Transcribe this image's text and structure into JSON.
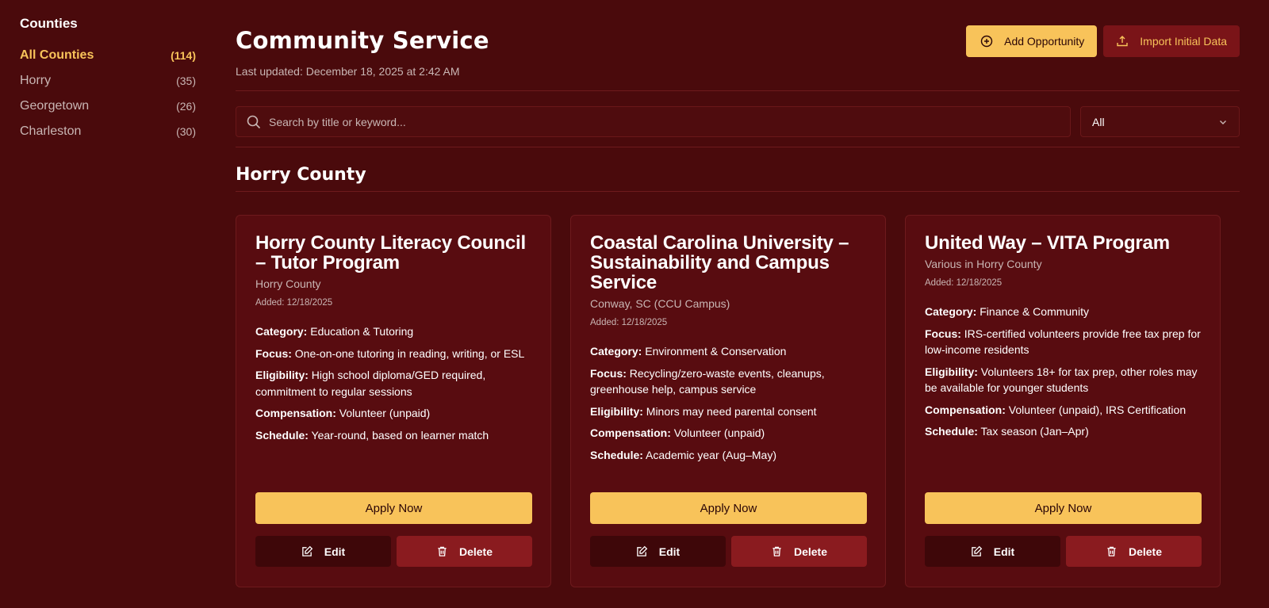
{
  "sidebar": {
    "heading": "Counties",
    "items": [
      {
        "label": "All Counties",
        "count": "(114)"
      },
      {
        "label": "Horry",
        "count": "(35)"
      },
      {
        "label": "Georgetown",
        "count": "(26)"
      },
      {
        "label": "Charleston",
        "count": "(30)"
      }
    ]
  },
  "header": {
    "title": "Community Service",
    "updated": "Last updated: December 18, 2025 at 2:42 AM",
    "add_label": "Add Opportunity",
    "import_label": "Import Initial Data"
  },
  "search": {
    "placeholder": "Search by title or keyword..."
  },
  "filter": {
    "selected": "All"
  },
  "section": {
    "title": "Horry County"
  },
  "labels": {
    "category": "Category:",
    "focus": "Focus:",
    "eligibility": "Eligibility:",
    "compensation": "Compensation:",
    "schedule": "Schedule:",
    "apply": "Apply Now",
    "edit": "Edit",
    "delete": "Delete"
  },
  "cards": [
    {
      "title": "Horry County Literacy Council – Tutor Program",
      "location": "Horry County",
      "added": "Added: 12/18/2025",
      "category": "Education & Tutoring",
      "focus": "One-on-one tutoring in reading, writing, or ESL",
      "eligibility": "High school diploma/GED required, commitment to regular sessions",
      "compensation": "Volunteer (unpaid)",
      "schedule": "Year-round, based on learner match"
    },
    {
      "title": "Coastal Carolina University – Sustainability and Campus Service",
      "location": "Conway, SC (CCU Campus)",
      "added": "Added: 12/18/2025",
      "category": "Environment & Conservation",
      "focus": "Recycling/zero-waste events, cleanups, greenhouse help, campus service",
      "eligibility": "Minors may need parental consent",
      "compensation": "Volunteer (unpaid)",
      "schedule": "Academic year (Aug–May)"
    },
    {
      "title": "United Way – VITA Program",
      "location": "Various in Horry County",
      "added": "Added: 12/18/2025",
      "category": "Finance & Community",
      "focus": "IRS-certified volunteers provide free tax prep for low-income residents",
      "eligibility": "Volunteers 18+ for tax prep, other roles may be available for younger students",
      "compensation": "Volunteer (unpaid), IRS Certification",
      "schedule": "Tax season (Jan–Apr)"
    }
  ],
  "colors": {
    "background": "#4a0a0c",
    "accent": "#f8c35a",
    "card": "#580c10",
    "danger": "#8a1b1f"
  }
}
